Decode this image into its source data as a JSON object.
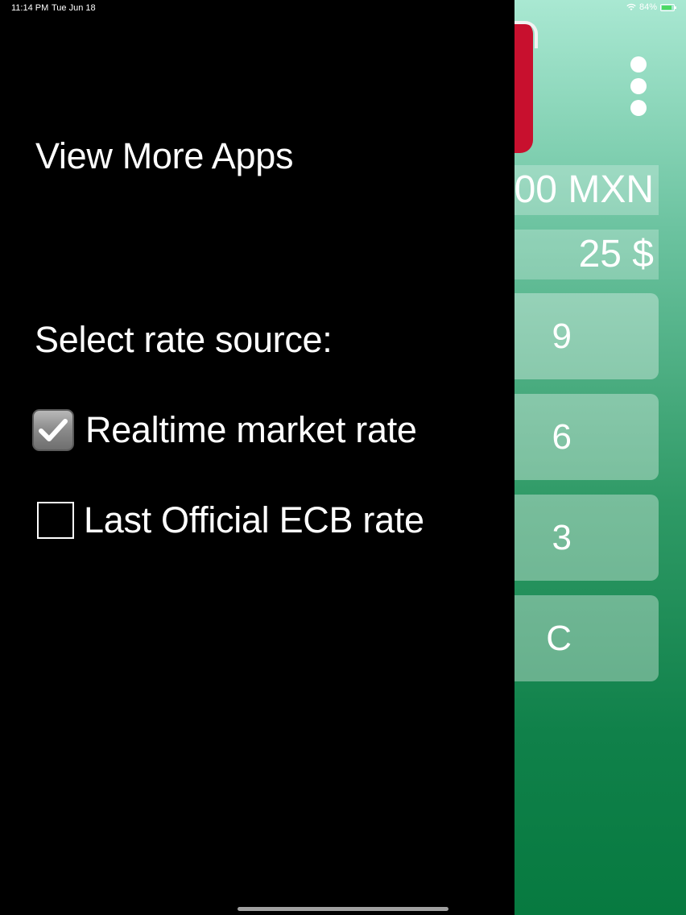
{
  "status_bar": {
    "time": "11:14 PM",
    "date": "Tue Jun 18",
    "battery": "84%"
  },
  "drawer": {
    "view_more": "View More Apps",
    "select_label": "Select rate source:",
    "options": [
      {
        "label": "Realtime market rate",
        "checked": true
      },
      {
        "label": "Last Official ECB rate",
        "checked": false
      }
    ]
  },
  "app": {
    "amount_1": "00 MXN",
    "amount_2": "25 $",
    "keys": [
      "9",
      "6",
      "3",
      "C"
    ],
    "colors": {
      "flag_red": "#c8102e",
      "gradient_top": "#a9e8d2",
      "gradient_bottom": "#077a40"
    }
  }
}
